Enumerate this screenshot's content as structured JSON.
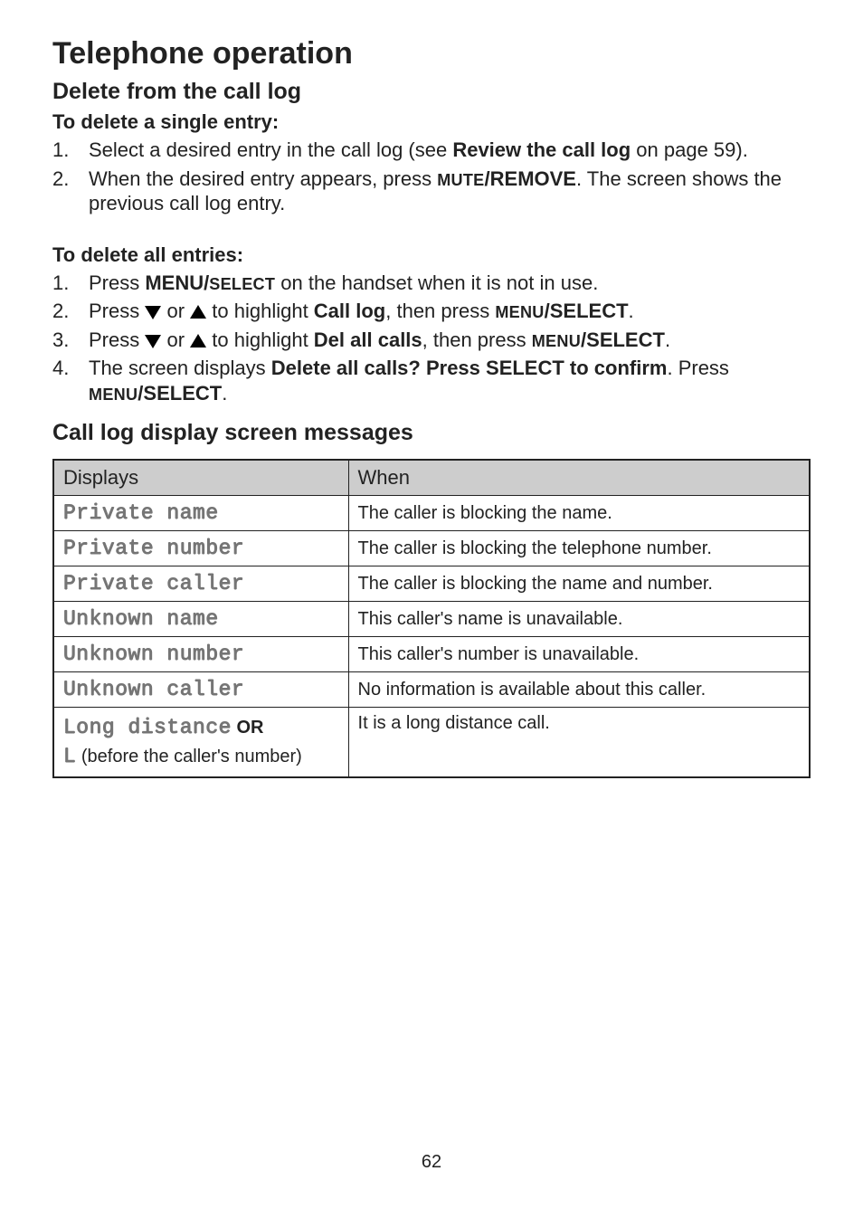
{
  "page": {
    "title": "Telephone operation",
    "pageNumber": "62"
  },
  "section1": {
    "heading": "Delete from the call log",
    "sub1": {
      "heading": "To delete a single entry:",
      "items": [
        {
          "num": "1.",
          "pre": "Select a desired entry in the call log (see ",
          "bold": "Review the call log",
          "post": " on page 59)."
        },
        {
          "num": "2.",
          "pre": "When the desired entry appears, press ",
          "sc": "MUTE",
          "bold2": "/REMOVE",
          "post": ". The screen shows the previous call log entry."
        }
      ]
    },
    "sub2": {
      "heading": "To delete all entries:",
      "items": [
        {
          "num": "1.",
          "pre": "Press ",
          "bold1": "MENU/",
          "sc1": "SELECT",
          "post": " on the handset when it is not in use."
        },
        {
          "num": "2.",
          "pre": "Press ",
          "mid1": " or ",
          "mid2": " to highlight ",
          "bold": "Call log",
          "post1": ", then press ",
          "sc": "MENU",
          "bold2": "/SELECT",
          "post2": "."
        },
        {
          "num": "3.",
          "pre": "Press ",
          "mid1": " or ",
          "mid2": " to highlight ",
          "bold": "Del all calls",
          "post1": ", then press ",
          "sc": "MENU",
          "bold2": "/SELECT",
          "post2": "."
        },
        {
          "num": "4.",
          "pre": "The screen displays ",
          "bold": "Delete all calls? Press SELECT to confirm",
          "post1": ". Press ",
          "sc": "MENU",
          "bold2": "/SELECT",
          "post2": "."
        }
      ]
    }
  },
  "section2": {
    "heading": "Call log display screen messages",
    "tableHeaders": {
      "col1": "Displays",
      "col2": "When"
    },
    "rows": [
      {
        "display": "Private name",
        "when": "The caller is blocking the name."
      },
      {
        "display": "Private number",
        "when": "The caller is blocking the telephone number."
      },
      {
        "display": "Private caller",
        "when": "The caller is blocking the name and number."
      },
      {
        "display": "Unknown name",
        "when": "This caller's name is unavailable."
      },
      {
        "display": "Unknown number",
        "when": "This caller's number is unavailable."
      },
      {
        "display": "Unknown caller",
        "when": "No information is available about this caller."
      }
    ],
    "lastRow": {
      "display": "Long distance",
      "or": " OR",
      "prefix": "L",
      "note": " (before the caller's number)",
      "when": "It is a long distance call."
    }
  }
}
